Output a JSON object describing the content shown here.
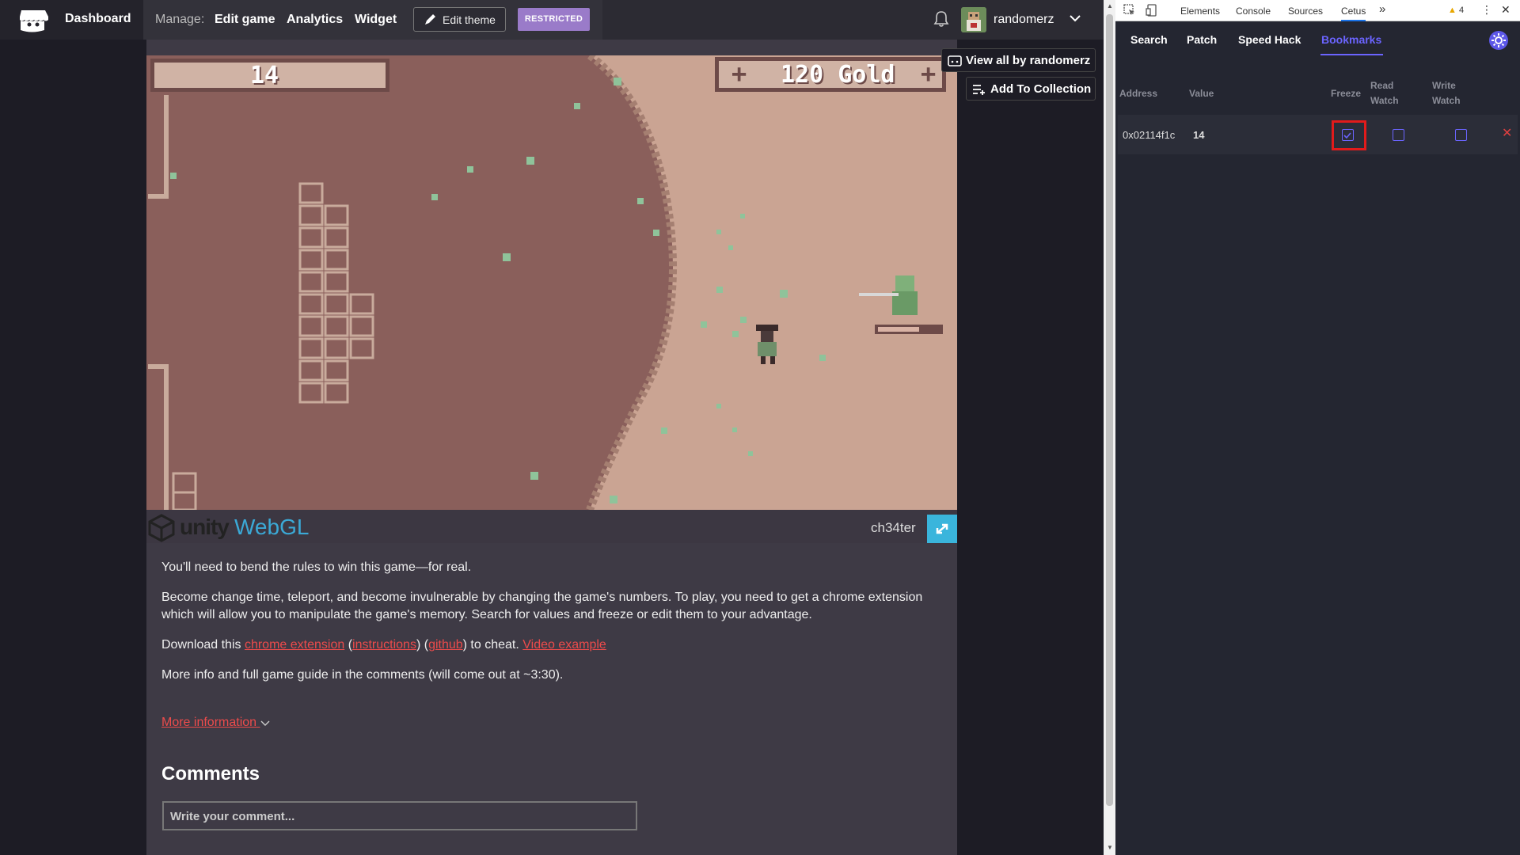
{
  "topbar": {
    "dashboard": "Dashboard",
    "manage_label": "Manage:",
    "links": [
      "Edit game",
      "Analytics",
      "Widget"
    ],
    "edit_theme": "Edit theme",
    "restricted": "RESTRICTED",
    "username": "randomerz"
  },
  "game": {
    "hud_left": "14",
    "hud_right": "120 Gold",
    "hud_plus": "+",
    "engine_brand": "unity",
    "engine_product": "WebGL",
    "title": "ch34ter"
  },
  "sidebar_buttons": {
    "view_all": "View all by randomerz",
    "add_collection": "Add To Collection"
  },
  "description": {
    "p1": "You'll need to bend the rules to win this game—for real.",
    "p2": "Become change time, teleport, and become invulnerable by changing the game's numbers. To play, you need to get a chrome extension which will allow you to manipulate the game's memory. Search for values and freeze or edit them to your advantage.",
    "p3_prefix": "Download this ",
    "p3_link1": "chrome extension",
    "p3_mid1": " (",
    "p3_link2": "instructions",
    "p3_mid2": ") (",
    "p3_link3": "github",
    "p3_mid3": ") to cheat. ",
    "p3_link4": "Video example",
    "p4": "More info and full game guide in the comments (will come out at ~3:30).",
    "more_info": "More information",
    "comments_heading": "Comments",
    "comment_placeholder": "Write your comment..."
  },
  "devtools": {
    "tabs": [
      "Elements",
      "Console",
      "Sources",
      "Cetus"
    ],
    "active_tab": "Cetus",
    "overflow": "»",
    "warnings_count": "4",
    "cetus_tabs": [
      "Search",
      "Patch",
      "Speed Hack",
      "Bookmarks"
    ],
    "active_cetus_tab": "Bookmarks",
    "columns": {
      "address": "Address",
      "value": "Value",
      "freeze": "Freeze",
      "read_watch_1": "Read",
      "read_watch_2": "Watch",
      "write_watch_1": "Write",
      "write_watch_2": "Watch"
    },
    "rows": [
      {
        "address": "0x02114f1c",
        "value": "14",
        "freeze": true,
        "read_watch": false,
        "write_watch": false
      }
    ],
    "colors": {
      "accent": "#6b64ff",
      "highlight": "#e21b1b"
    }
  }
}
